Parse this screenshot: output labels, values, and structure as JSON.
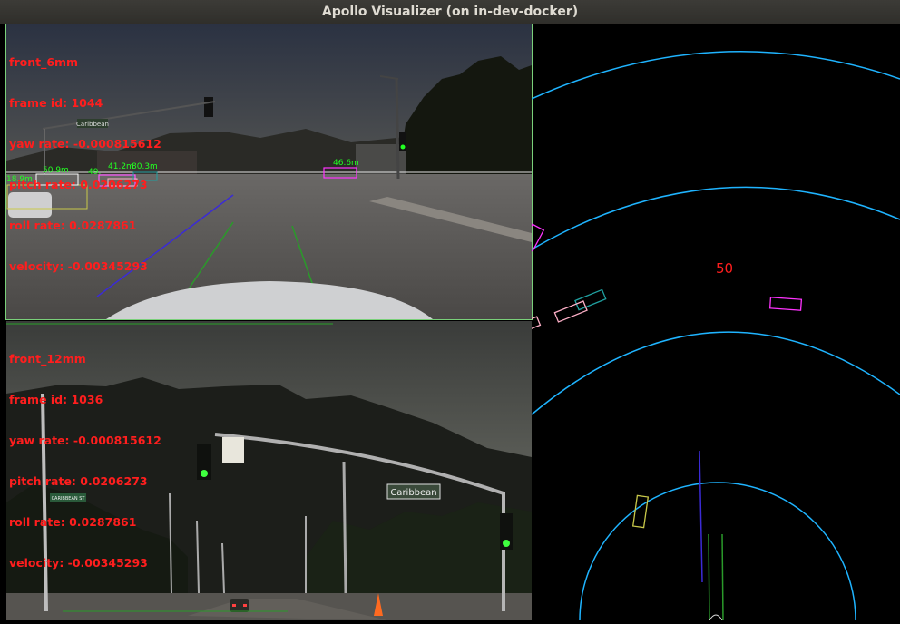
{
  "window": {
    "title": "Apollo Visualizer (on in-dev-docker)"
  },
  "front_6mm": {
    "lines": [
      "front_6mm",
      "frame id: 1044",
      "yaw rate: -0.000815612",
      "pitch rate: 0.0206273",
      "roll rate: 0.0287861",
      "velocity: -0.00345293"
    ],
    "distances": [
      "18.9m",
      "50.9m",
      "49.",
      "41.2m",
      "80.3m",
      "46.6m"
    ],
    "sign_text": "Caribbean"
  },
  "front_12mm": {
    "lines": [
      "front_12mm",
      "frame id: 1036",
      "yaw rate: -0.000815612",
      "pitch rate: 0.0206273",
      "roll rate: 0.0287861",
      "velocity: -0.00345293"
    ],
    "sign_text": "Caribbean",
    "small_sign": "CARIBBEAN ST"
  },
  "bev": {
    "range_label": "50"
  },
  "colors": {
    "overlay_text": "#ff1e1e",
    "range_ring": "#1fb4ff",
    "panel_border": "#7ad07a"
  }
}
